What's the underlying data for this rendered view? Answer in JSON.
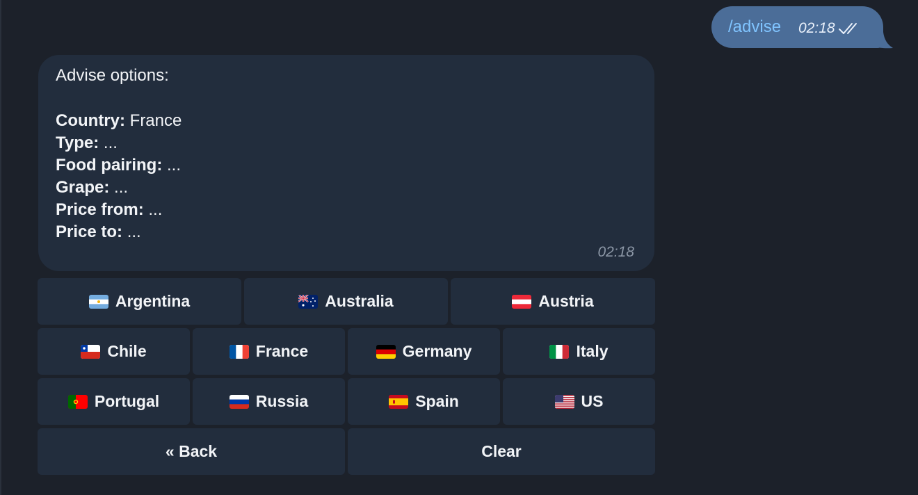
{
  "outgoing": {
    "text": "/advise",
    "time": "02:18",
    "status_icon": "double-check-icon"
  },
  "incoming": {
    "header": "Advise options:",
    "fields": [
      {
        "label": "Country:",
        "value": "France"
      },
      {
        "label": "Type:",
        "value": "..."
      },
      {
        "label": "Food pairing:",
        "value": "..."
      },
      {
        "label": "Grape:",
        "value": "..."
      },
      {
        "label": "Price from:",
        "value": "..."
      },
      {
        "label": "Price to:",
        "value": "..."
      }
    ],
    "time": "02:18"
  },
  "keyboard": {
    "countries": [
      {
        "label": "Argentina",
        "flag": "argentina-flag-icon"
      },
      {
        "label": "Australia",
        "flag": "australia-flag-icon"
      },
      {
        "label": "Austria",
        "flag": "austria-flag-icon"
      },
      {
        "label": "Chile",
        "flag": "chile-flag-icon"
      },
      {
        "label": "France",
        "flag": "france-flag-icon"
      },
      {
        "label": "Germany",
        "flag": "germany-flag-icon"
      },
      {
        "label": "Italy",
        "flag": "italy-flag-icon"
      },
      {
        "label": "Portugal",
        "flag": "portugal-flag-icon"
      },
      {
        "label": "Russia",
        "flag": "russia-flag-icon"
      },
      {
        "label": "Spain",
        "flag": "spain-flag-icon"
      },
      {
        "label": "US",
        "flag": "us-flag-icon"
      }
    ],
    "back_label": "« Back",
    "clear_label": "Clear"
  },
  "colors": {
    "background": "#1c212a",
    "bubble_incoming": "#222d3d",
    "bubble_outgoing": "#4b6d98",
    "command_link": "#80c4ff"
  }
}
